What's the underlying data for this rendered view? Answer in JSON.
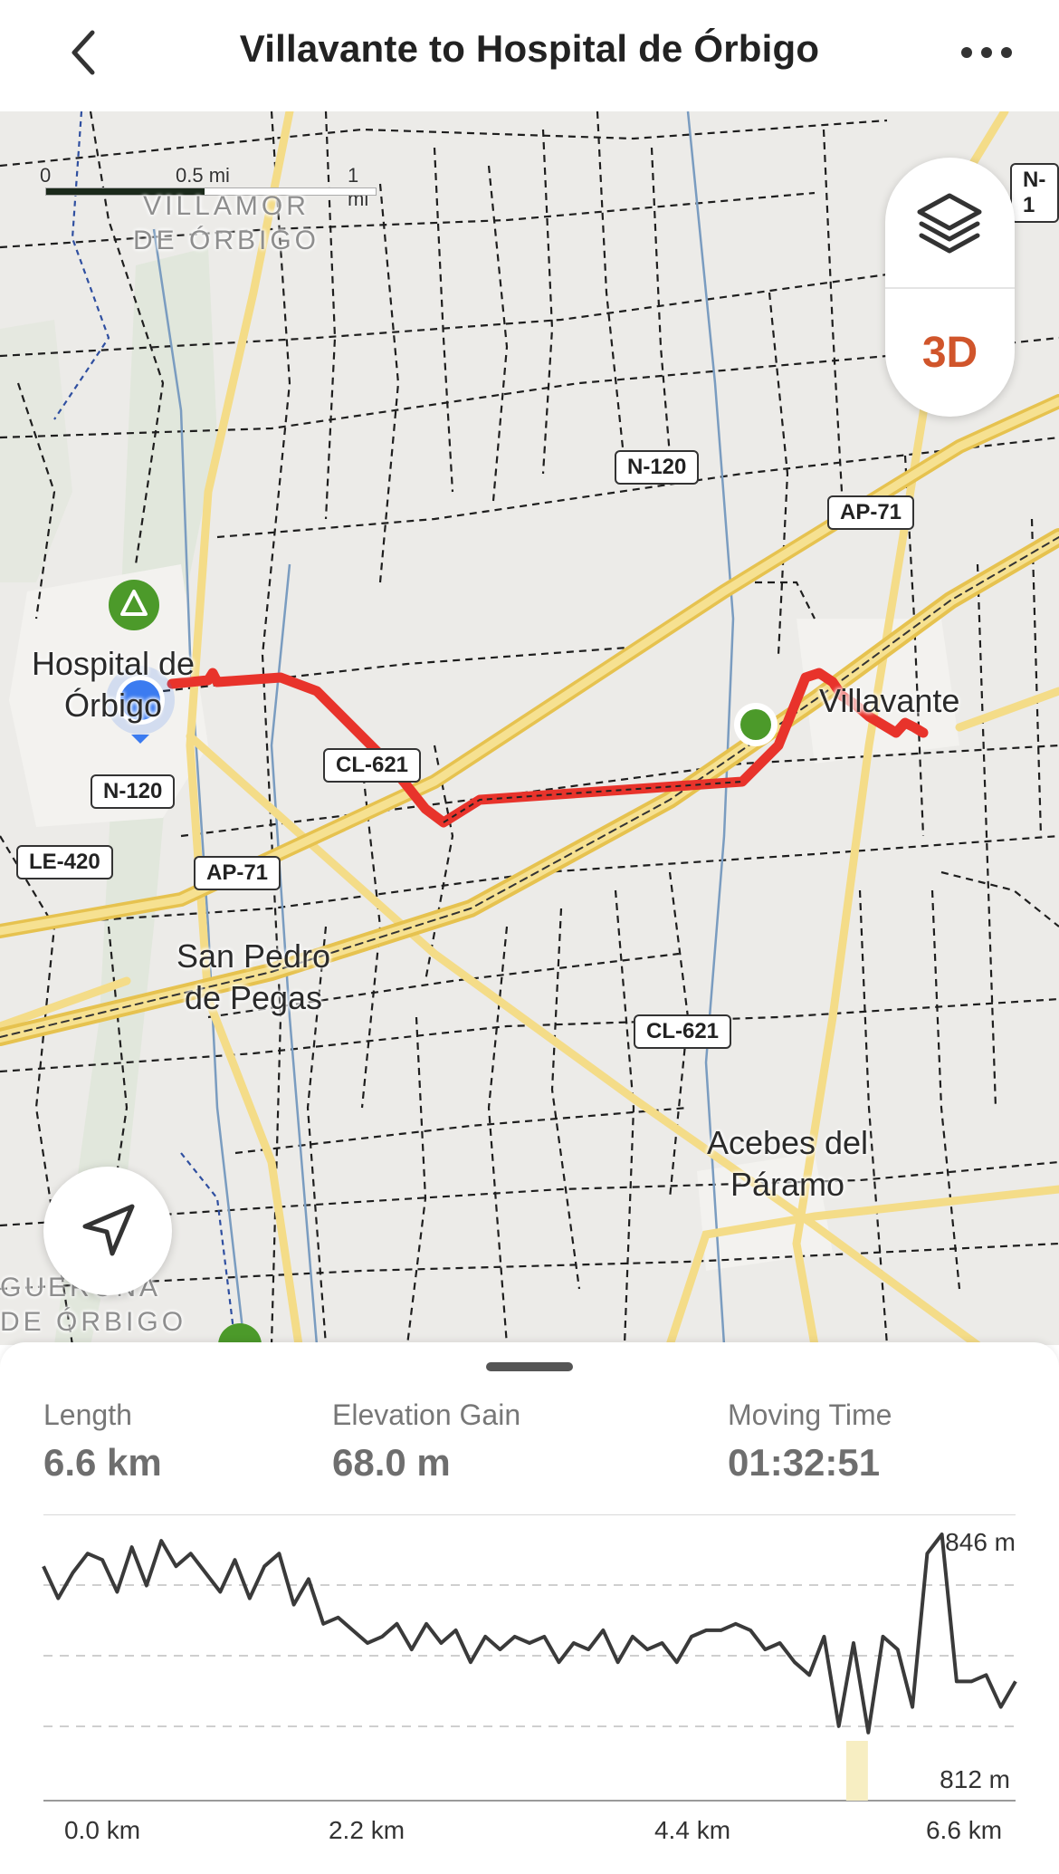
{
  "header": {
    "title": "Villavante to Hospital de Órbigo",
    "back_icon": "chevron-left-icon",
    "more_icon": "more-horizontal-icon"
  },
  "map": {
    "scale": {
      "labels": [
        "0",
        "0.5 mi",
        "1 mi"
      ]
    },
    "places": {
      "villamor": "VILLAMOR DE ÓRBIGO",
      "hospital": "Hospital de Órbigo",
      "villavante": "Villavante",
      "san_pedro": "San Pedro de Pegas",
      "acebes": "Acebes del Páramo",
      "gueruna": "GUERUÑA DE ÓRBIGO"
    },
    "roads": {
      "n120_top": "N-120",
      "n120_left": "N-120",
      "n1_edge": "N-1",
      "ap71_right": "AP-71",
      "ap71_left": "AP-71",
      "cl621_mid": "CL-621",
      "cl621_low": "CL-621",
      "le420": "LE-420"
    },
    "controls": {
      "layers_icon": "layers-icon",
      "btn_3d": "3D",
      "locate_icon": "navigation-arrow-icon"
    },
    "colors": {
      "route": "#e8332b",
      "start": "#4c9a2a",
      "location": "#3b7bf0",
      "road": "#f2d675",
      "highway": "#e9c550"
    }
  },
  "stats": {
    "length": {
      "label": "Length",
      "value": "6.6 km"
    },
    "elevation_gain": {
      "label": "Elevation Gain",
      "value": "68.0 m"
    },
    "moving_time": {
      "label": "Moving Time",
      "value": "01:32:51"
    }
  },
  "chart_data": {
    "type": "line",
    "title": "",
    "xlabel": "",
    "ylabel": "",
    "x_tick_labels": [
      "0.0 km",
      "2.2 km",
      "4.4 km",
      "6.6 km"
    ],
    "y_tick_labels": [
      "846 m",
      "812 m"
    ],
    "xlim": [
      0,
      6.6
    ],
    "ylim": [
      812,
      846
    ],
    "grid": true,
    "series": [
      {
        "x": [
          0.0,
          0.1,
          0.2,
          0.3,
          0.4,
          0.5,
          0.6,
          0.7,
          0.8,
          0.9,
          1.0,
          1.1,
          1.2,
          1.3,
          1.4,
          1.5,
          1.6,
          1.7,
          1.8,
          1.9,
          2.0,
          2.1,
          2.2,
          2.3,
          2.4,
          2.5,
          2.6,
          2.7,
          2.8,
          2.9,
          3.0,
          3.1,
          3.2,
          3.3,
          3.4,
          3.5,
          3.6,
          3.7,
          3.8,
          3.9,
          4.0,
          4.1,
          4.2,
          4.3,
          4.4,
          4.5,
          4.6,
          4.7,
          4.8,
          4.9,
          5.0,
          5.1,
          5.2,
          5.3,
          5.4,
          5.5,
          5.6,
          5.7,
          5.8,
          5.9,
          6.0,
          6.1,
          6.2,
          6.3,
          6.4,
          6.5,
          6.6
        ],
        "values": [
          841,
          836,
          840,
          843,
          842,
          837,
          844,
          838,
          845,
          841,
          843,
          840,
          837,
          842,
          836,
          841,
          843,
          835,
          839,
          832,
          833,
          831,
          829,
          830,
          832,
          828,
          832,
          829,
          831,
          826,
          830,
          828,
          830,
          829,
          830,
          826,
          829,
          828,
          831,
          826,
          830,
          828,
          829,
          826,
          830,
          831,
          831,
          832,
          831,
          828,
          829,
          826,
          824,
          830,
          816,
          829,
          815,
          830,
          828,
          819,
          843,
          846,
          823,
          823,
          824,
          819,
          823
        ]
      }
    ]
  }
}
